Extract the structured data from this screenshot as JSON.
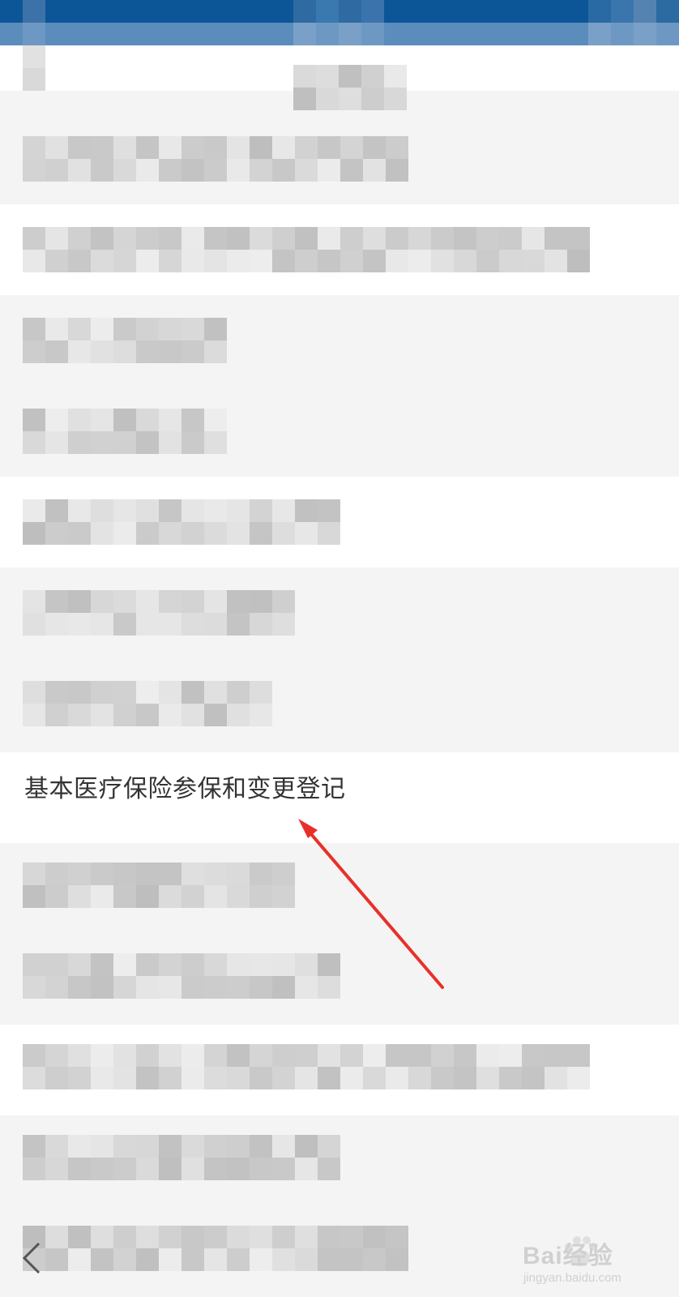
{
  "list": {
    "highlighted_item_label": "基本医疗保险参保和变更登记"
  },
  "watermark": {
    "brand": "Bai经验",
    "url": "jingyan.baidu.com"
  },
  "icons": {
    "back": "back-chevron-icon",
    "watermark_paw": "paw-icon",
    "annotation": "red-arrow"
  },
  "colors": {
    "topbar_dark": "#0c5698",
    "topbar_light": "#5a8cbc",
    "row_white": "#ffffff",
    "row_gray": "#f4f4f4",
    "label_text": "#333333",
    "arrow": "#e8302a"
  }
}
